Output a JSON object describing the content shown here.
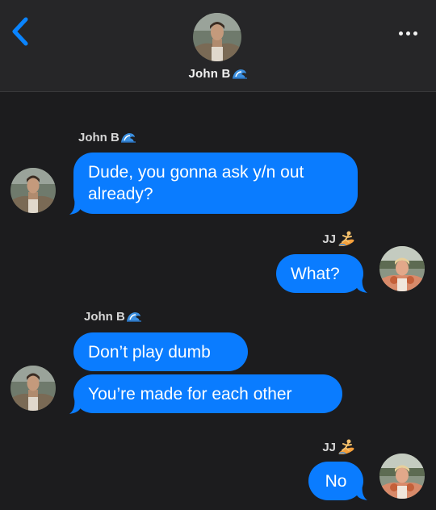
{
  "header": {
    "contact_name": "John B",
    "contact_emoji_icon": "wave-emoji-icon",
    "back_icon": "chevron-left-icon",
    "more_icon": "ellipsis-icon"
  },
  "colors": {
    "background": "#1c1c1e",
    "header_background": "#262628",
    "bubble_blue": "#0a7cff",
    "accent_blue": "#0a84ff"
  },
  "messages": [
    {
      "sender": "John B",
      "sender_emoji": "wave-emoji-icon",
      "side": "left",
      "texts": [
        "Dude, you gonna ask y/n out already?"
      ]
    },
    {
      "sender": "JJ",
      "sender_emoji": "surfer-emoji-icon",
      "side": "right",
      "texts": [
        "What?"
      ]
    },
    {
      "sender": "John B",
      "sender_emoji": "wave-emoji-icon",
      "side": "left",
      "texts": [
        "Don’t play dumb",
        "You’re made for each other"
      ]
    },
    {
      "sender": "JJ",
      "sender_emoji": "surfer-emoji-icon",
      "side": "right",
      "texts": [
        "No"
      ]
    }
  ]
}
